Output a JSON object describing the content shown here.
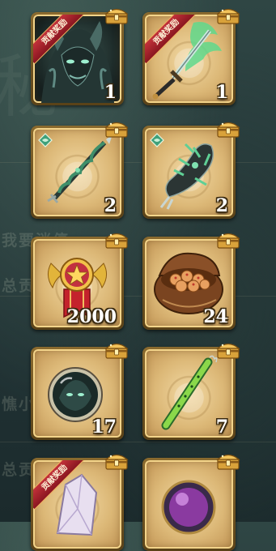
{
  "background": {
    "watermark_lines": [
      "我要消停",
      "总贡",
      "憔小",
      "总贡"
    ]
  },
  "items": [
    {
      "name": "dark-beast-portrait",
      "quantity": "1",
      "badge": "贡献奖励",
      "icon": "beast-portrait-icon"
    },
    {
      "name": "jade-flame-sword",
      "quantity": "1",
      "badge": "贡献奖励",
      "icon": "flame-sword-icon"
    },
    {
      "name": "serpent-spear",
      "quantity": "2",
      "badge": "",
      "icon": "spear-icon",
      "gem": true
    },
    {
      "name": "spiked-gauntlet",
      "quantity": "2",
      "badge": "",
      "icon": "gauntlet-icon",
      "gem": true
    },
    {
      "name": "star-medal",
      "quantity": "2000",
      "badge": "",
      "icon": "medal-icon"
    },
    {
      "name": "bun-pot",
      "quantity": "24",
      "badge": "",
      "icon": "food-pot-icon"
    },
    {
      "name": "soul-orb",
      "quantity": "17",
      "badge": "",
      "icon": "orb-icon"
    },
    {
      "name": "jade-flute",
      "quantity": "7",
      "badge": "",
      "icon": "flute-icon"
    },
    {
      "name": "crystal-shard",
      "quantity": "",
      "badge": "贡献奖励",
      "icon": "crystal-icon"
    },
    {
      "name": "purple-orb",
      "quantity": "",
      "badge": "",
      "icon": "purple-orb-icon"
    }
  ],
  "colors": {
    "card_border": "#8a6a2e",
    "card_bg": "#dcb877",
    "ribbon": "#a8222c",
    "quantity_text": "#ffffff"
  }
}
